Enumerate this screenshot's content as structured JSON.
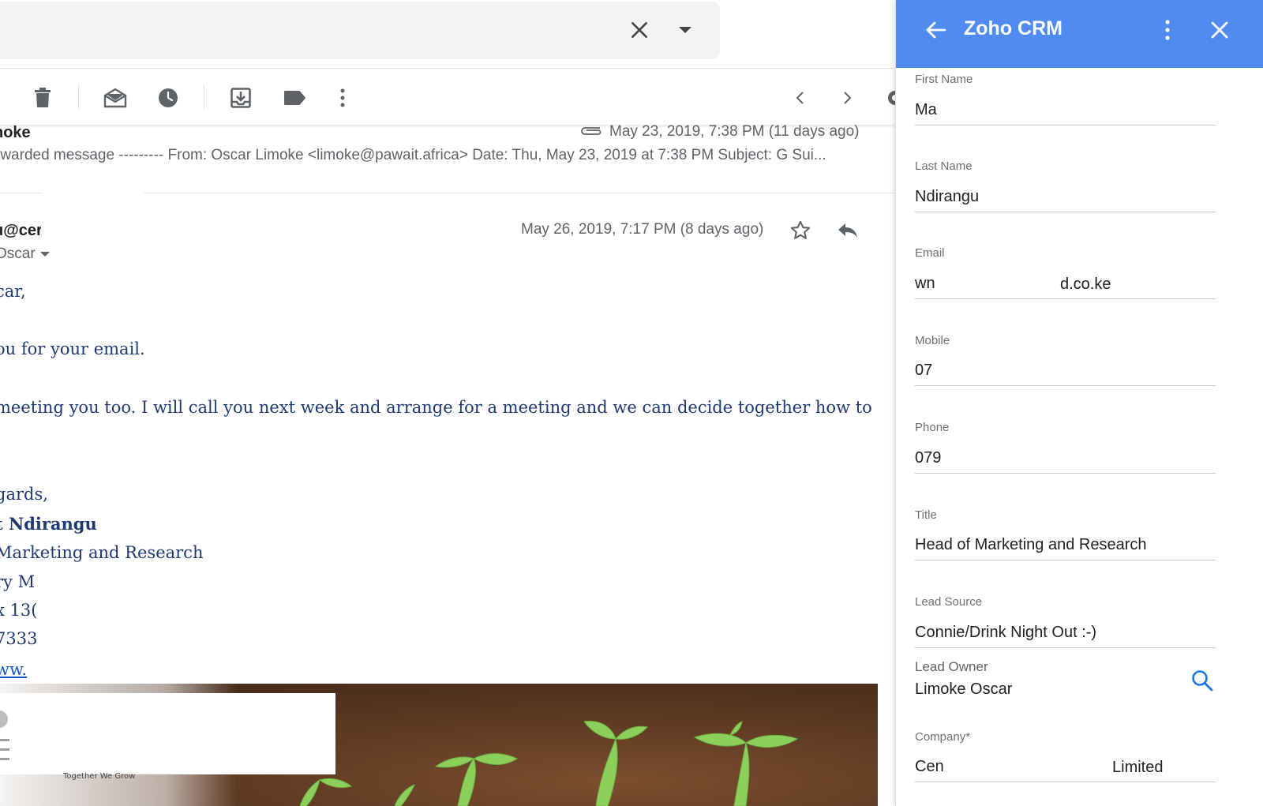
{
  "gmail": {
    "toolbar": {
      "delete": "trash-icon",
      "mark_unread": "mail-open-icon",
      "snooze": "clock-icon",
      "move_to": "move-to-inbox-icon",
      "labels": "label-icon",
      "more": "more-vert-icon",
      "newer": "chevron-left-icon",
      "older": "chevron-right-icon"
    },
    "message1": {
      "sender": "noke",
      "date": "May 23, 2019, 7:38 PM (11 days ago)",
      "snippet": "rwarded message --------- From: Oscar Limoke <limoke@pawait.africa> Date: Thu, May 23, 2019 at 7:38 PM Subject: G Sui..."
    },
    "message2": {
      "sender": "u@cer",
      "to": "Oscar",
      "date": "May 26, 2019, 7:17 PM (8 days ago)",
      "body": [
        "car,",
        "ou for your email.",
        " meeting you too. I will call you next week and arrange for a meeting and we can decide together how to"
      ],
      "signature": {
        "closing": "gards,",
        "name": "t Ndirangu",
        "title": "Marketing and Research",
        "line4": "ry M",
        "line5": "x 13(",
        "line6": "7333",
        "link": "ww."
      }
    },
    "banner": {
      "tagline": "Together We Grow"
    }
  },
  "crm": {
    "title": "Zoho CRM",
    "colors": {
      "header": "#4f8bf0",
      "accent": "#1a73e8"
    },
    "fields": {
      "first_name": {
        "label": "First Name",
        "value": "Ma"
      },
      "last_name": {
        "label": "Last Name",
        "value": "Ndirangu"
      },
      "email": {
        "label": "Email",
        "value": "wn",
        "value_suffix": "d.co.ke"
      },
      "mobile": {
        "label": "Mobile",
        "value": "07"
      },
      "phone": {
        "label": "Phone",
        "value": "079"
      },
      "title": {
        "label": "Title",
        "value": "Head of Marketing and Research"
      },
      "lead_source": {
        "label": "Lead Source",
        "value": "Connie/Drink Night Out :-)"
      },
      "lead_owner": {
        "label": "Lead Owner",
        "value": "Limoke Oscar"
      },
      "company": {
        "label": "Company*",
        "value": "Cen",
        "value_suffix": "Limited"
      }
    }
  }
}
